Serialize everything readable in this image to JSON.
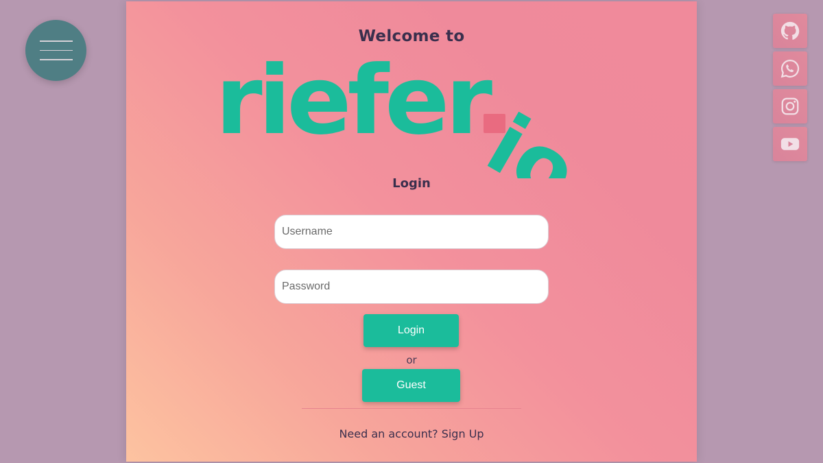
{
  "menu": {
    "icon": "hamburger-icon"
  },
  "header": {
    "welcome": "Welcome to",
    "logo_main": "riefer",
    "logo_suffix": "io",
    "brand_color": "#1bbc9b",
    "dot_color": "#e96b80"
  },
  "login": {
    "title": "Login",
    "username_placeholder": "Username",
    "password_placeholder": "Password",
    "login_label": "Login",
    "or_label": "or",
    "guest_label": "Guest",
    "signup_prompt": "Need an account?",
    "signup_link": "Sign Up"
  },
  "social": [
    {
      "icon": "github-icon"
    },
    {
      "icon": "whatsapp-icon"
    },
    {
      "icon": "instagram-icon"
    },
    {
      "icon": "youtube-icon"
    }
  ]
}
